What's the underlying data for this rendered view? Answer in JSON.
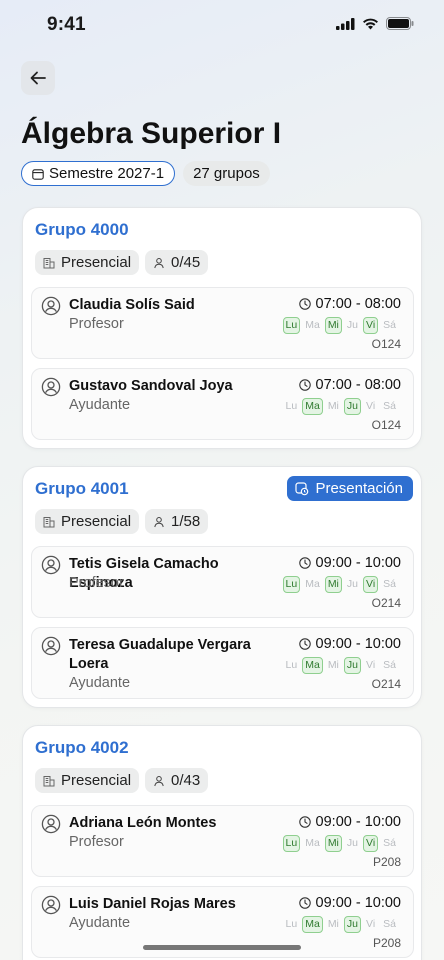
{
  "status": {
    "time": "9:41"
  },
  "course": {
    "title": "Álgebra Superior I",
    "semester": "Semestre 2027-1",
    "groups_count": "27 grupos"
  },
  "groups": [
    {
      "title": "Grupo 4000",
      "modality": "Presencial",
      "enrollment": "0/45",
      "staff": [
        {
          "name": "Claudia Solís Said",
          "role": "Profesor",
          "time": "07:00 - 08:00",
          "room": "O124"
        },
        {
          "name": "Gustavo Sandoval Joya",
          "role": "Ayudante",
          "time": "07:00 - 08:00",
          "room": "O124"
        }
      ]
    },
    {
      "title": "Grupo 4001",
      "presentation_label": "Presentación",
      "modality": "Presencial",
      "enrollment": "1/58",
      "staff": [
        {
          "name": "Tetis Gisela Camacho Espinoza",
          "role": "Profesor",
          "time": "09:00 - 10:00",
          "room": "O214"
        },
        {
          "name": "Teresa Guadalupe Vergara Loera",
          "role": "Ayudante",
          "time": "09:00 - 10:00",
          "room": "O214"
        }
      ]
    },
    {
      "title": "Grupo 4002",
      "modality": "Presencial",
      "enrollment": "0/43",
      "staff": [
        {
          "name": "Adriana León Montes",
          "role": "Profesor",
          "time": "09:00 - 10:00",
          "room": "P208"
        },
        {
          "name": "Luis Daniel Rojas Mares",
          "role": "Ayudante",
          "time": "09:00 - 10:00",
          "room": "P208"
        }
      ]
    }
  ],
  "days": [
    "Lu",
    "Ma",
    "Mi",
    "Ju",
    "Vi",
    "Sá"
  ],
  "day_patterns": {
    "profesor": [
      "Lu",
      "Mi",
      "Vi"
    ],
    "ayudante": [
      "Ma",
      "Ju"
    ]
  },
  "colors": {
    "accent": "#2f6fd0",
    "day_active_bg": "#e4f4e4",
    "day_active_text": "#2f7a2f"
  }
}
